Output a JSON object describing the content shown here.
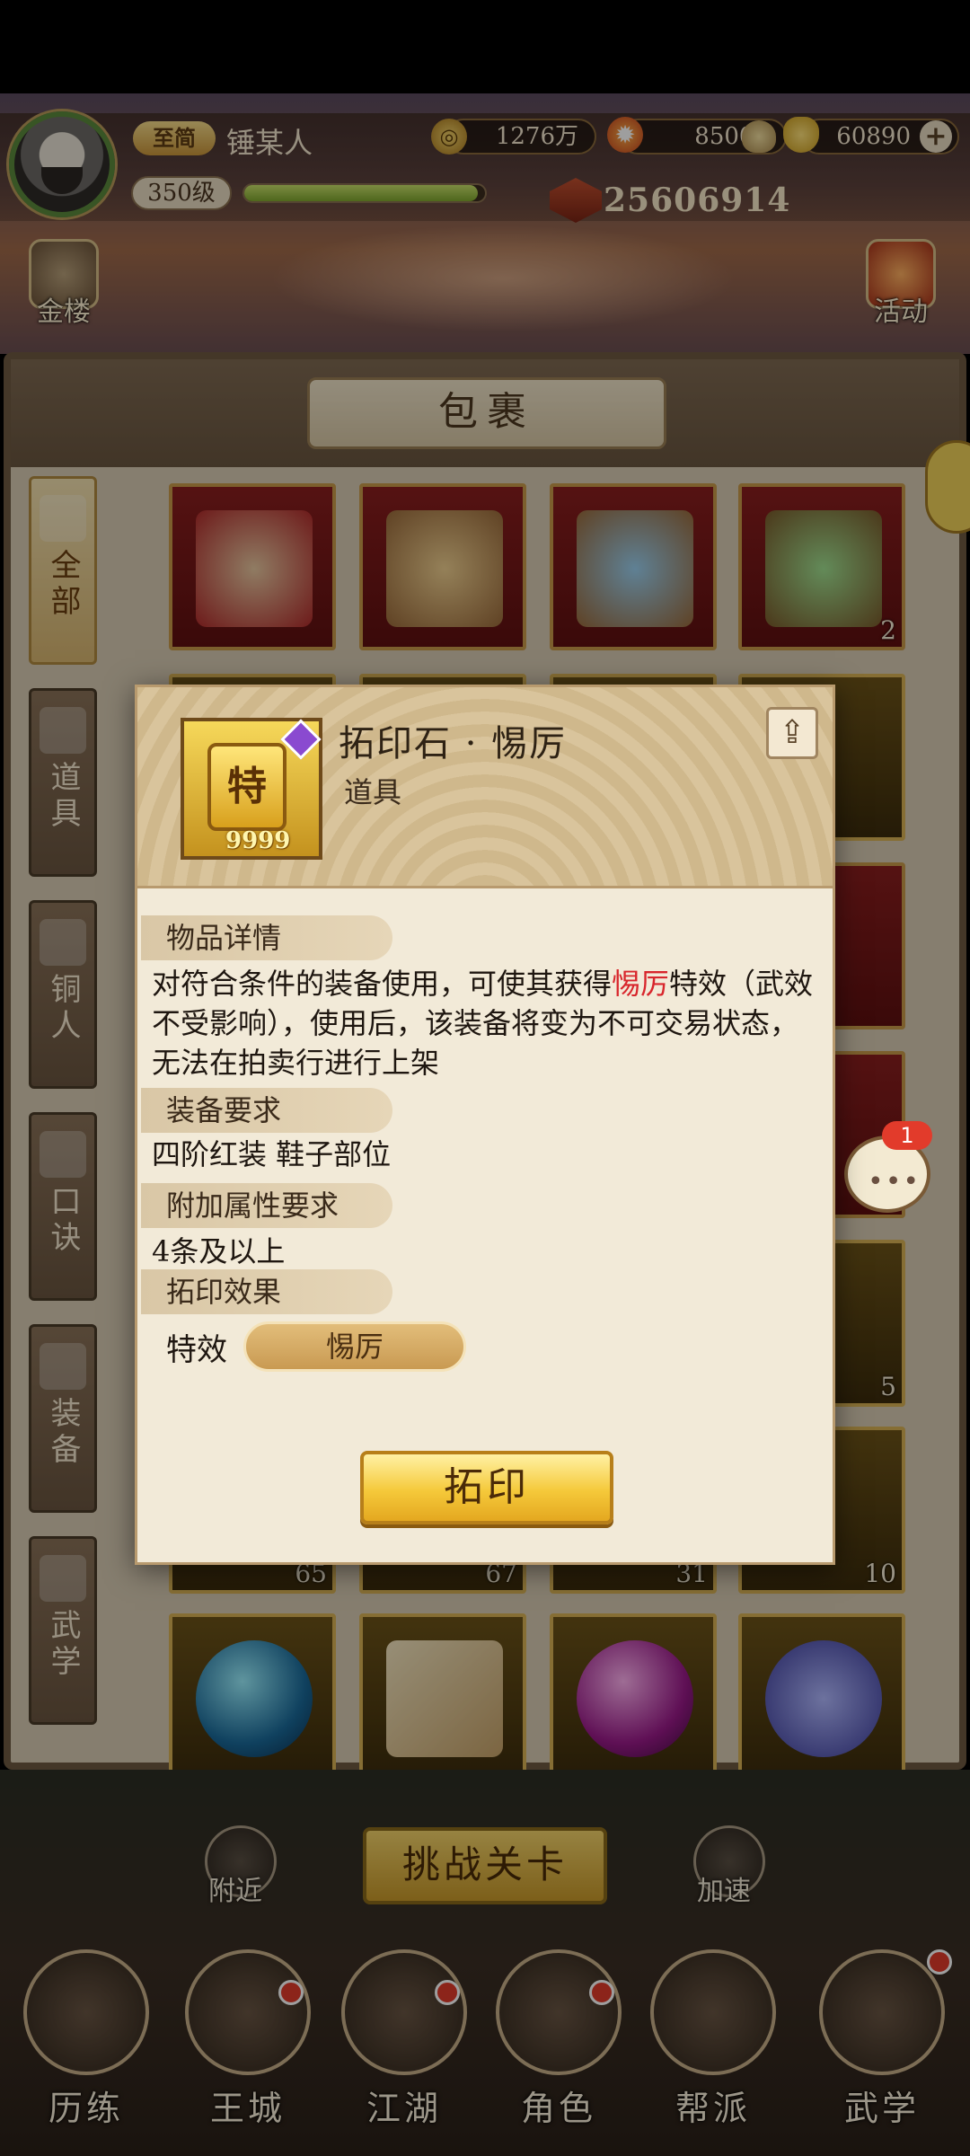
{
  "player": {
    "vip": "至简",
    "name": "锤某人",
    "level": "350级",
    "xp_fraction": 0.97,
    "power": "25606914"
  },
  "resources": [
    {
      "icon": "coin-icon",
      "value": "1276万"
    },
    {
      "icon": "flame-token-icon",
      "value": "85000"
    },
    {
      "icon": "gold-ingot-icon",
      "value": "60890"
    }
  ],
  "side_buttons": {
    "left": "金楼",
    "right": "活动"
  },
  "panel": {
    "title": "包裹"
  },
  "categories": [
    {
      "label": "全部",
      "selected": true
    },
    {
      "label": "道具",
      "selected": false
    },
    {
      "label": "铜人",
      "selected": false
    },
    {
      "label": "口诀",
      "selected": false
    },
    {
      "label": "装备",
      "selected": false
    },
    {
      "label": "武学",
      "selected": false
    }
  ],
  "grid_counts": {
    "r1c4": "2",
    "r5c4": "5",
    "r6c1": "65",
    "r6c2": "67",
    "r6c3": "31",
    "r6c4": "10"
  },
  "chat": {
    "badge": "1"
  },
  "modal": {
    "item_name": "拓印石 · 惕厉",
    "item_type": "道具",
    "item_qty": "9999",
    "item_glyph": "特",
    "sections": {
      "details_title": "物品详情",
      "details_pre": "对符合条件的装备使用，可使其获得",
      "details_highlight": "惕厉",
      "details_post": "特效（武效不受影响），使用后，该装备将变为不可交易状态，无法在拍卖行进行上架",
      "equip_req_title": "装备要求",
      "equip_req_text": "四阶红装 鞋子部位",
      "attr_req_title": "附加属性要求",
      "attr_req_text": "4条及以上",
      "effect_title": "拓印效果",
      "effect_label": "特效",
      "effect_value": "惕厉"
    },
    "action": "拓印"
  },
  "bottom": {
    "challenge": "挑战关卡",
    "nearby": "附近",
    "speedup": "加速"
  },
  "nav": [
    "历练",
    "王城",
    "江湖",
    "角色",
    "帮派",
    "武学"
  ]
}
